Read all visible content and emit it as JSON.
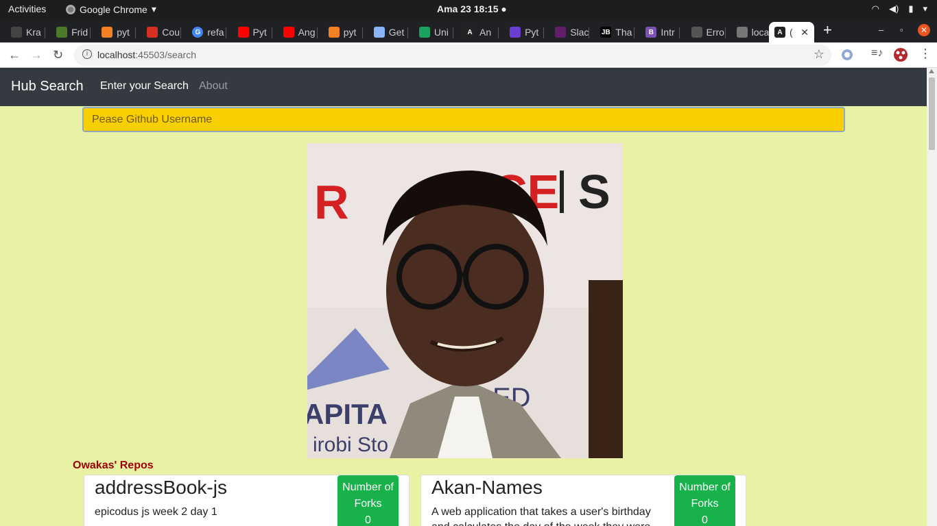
{
  "system": {
    "activities": "Activities",
    "app_name": "Google Chrome",
    "clock": "Ama 23  18:15"
  },
  "browser": {
    "tabs": [
      {
        "label": "Kra",
        "icon": "github-icon"
      },
      {
        "label": "Frid",
        "icon": "palm-icon"
      },
      {
        "label": "pyt",
        "icon": "stackoverflow-icon"
      },
      {
        "label": "Cou",
        "icon": "gmail-icon"
      },
      {
        "label": "refa",
        "icon": "google-icon"
      },
      {
        "label": "Pyt",
        "icon": "youtube-icon"
      },
      {
        "label": "Ang",
        "icon": "youtube-icon"
      },
      {
        "label": "pyt",
        "icon": "stackoverflow-icon"
      },
      {
        "label": "Get",
        "icon": "puzzle-icon"
      },
      {
        "label": "Uni",
        "icon": "infinity-icon"
      },
      {
        "label": "An",
        "icon": "angular-icon"
      },
      {
        "label": "Pyt",
        "icon": "devto-icon"
      },
      {
        "label": "Slac",
        "icon": "slack-icon"
      },
      {
        "label": "Tha",
        "icon": "jetbrains-icon"
      },
      {
        "label": "Intr",
        "icon": "bootstrap-icon"
      },
      {
        "label": "Erro",
        "icon": "error-icon"
      },
      {
        "label": "loca",
        "icon": "globe-icon"
      },
      {
        "label": "(",
        "icon": "angular-icon"
      }
    ],
    "url_host": "localhost",
    "url_path": ":45503/search"
  },
  "app": {
    "brand": "Hub Search",
    "nav_search": "Enter your Search",
    "nav_about": "About",
    "search_placeholder": "Pease Github Username",
    "repos_title": "Owakas' Repos",
    "repos": [
      {
        "name": "addressBook-js",
        "description": "epicodus js week 2 day 1",
        "forks_label": "Number of Forks",
        "forks": "0"
      },
      {
        "name": "Akan-Names",
        "description": "A web application that takes a user's birthday and calculates the day of the week they were",
        "forks_label": "Number of Forks",
        "forks": "0"
      }
    ]
  },
  "colors": {
    "page_bg": "#e9f2a4",
    "navbar": "#343a40",
    "search_bg": "#f9cf00",
    "forks_badge": "#18b24b",
    "repos_title": "#a00000"
  }
}
